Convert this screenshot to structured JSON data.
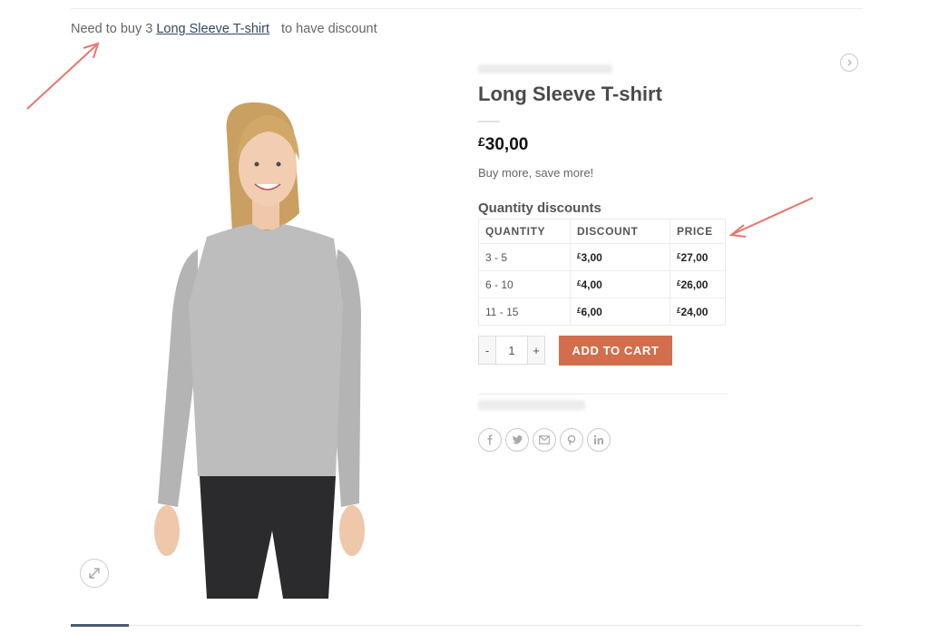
{
  "notice": {
    "prefix": "Need to buy 3",
    "link": "Long Sleeve T-shirt",
    "suffix": "to have discount"
  },
  "product": {
    "title": "Long Sleeve T-shirt",
    "price_currency": "£",
    "price_amount": "30,00",
    "short_description": "Buy more, save more!"
  },
  "quantity_discounts": {
    "title": "Quantity discounts",
    "headers": [
      "QUANTITY",
      "DISCOUNT",
      "PRICE"
    ],
    "rows": [
      {
        "quantity": "3 - 5",
        "discount": "3,00",
        "price": "27,00"
      },
      {
        "quantity": "6 - 10",
        "discount": "4,00",
        "price": "26,00"
      },
      {
        "quantity": "11 - 15",
        "discount": "6,00",
        "price": "24,00"
      }
    ],
    "currency": "£"
  },
  "cart": {
    "minus": "-",
    "quantity_value": "1",
    "plus": "+",
    "add_to_cart": "ADD TO CART"
  },
  "share_icons": [
    "facebook-icon",
    "twitter-icon",
    "email-icon",
    "pinterest-icon",
    "linkedin-icon"
  ],
  "colors": {
    "accent": "#d26e4b",
    "link": "#334862",
    "annotation_arrow": "#e8766b"
  }
}
